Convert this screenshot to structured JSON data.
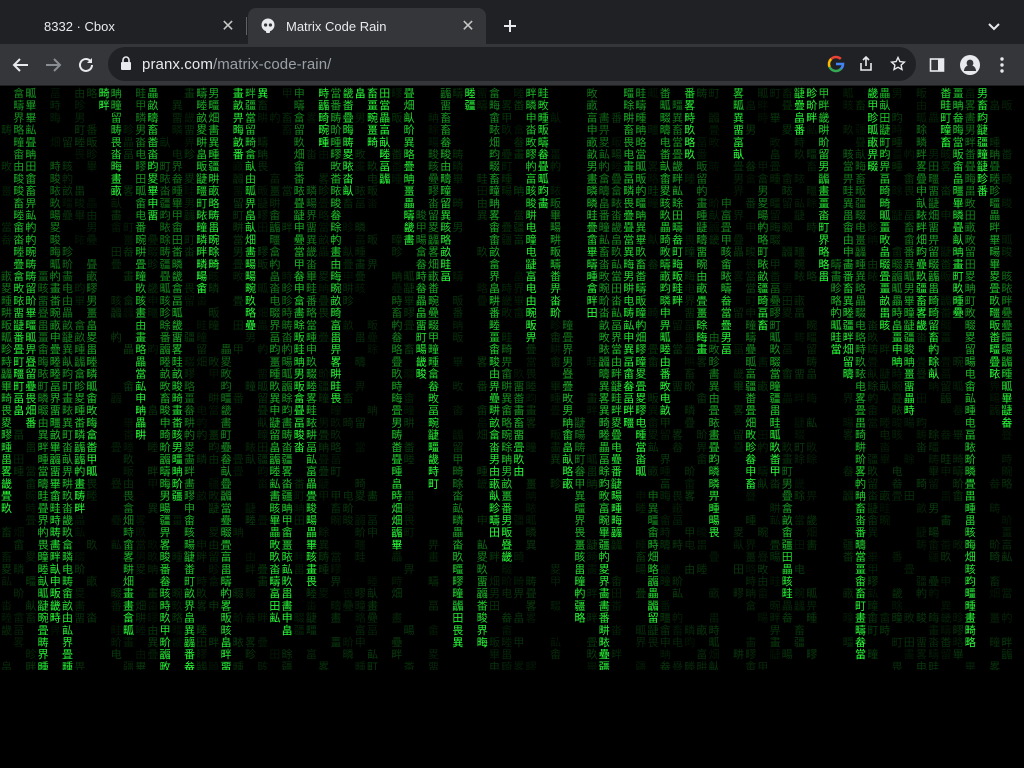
{
  "tabs": [
    {
      "title": "8332 · Cbox",
      "active": false
    },
    {
      "title": "Matrix Code Rain",
      "active": true
    }
  ],
  "toolbar": {
    "url_host": "pranx.com",
    "url_path": "/matrix-code-rain/"
  },
  "icons": {
    "back": "back-arrow-icon",
    "forward": "forward-arrow-icon",
    "reload": "reload-icon",
    "lock": "lock-icon",
    "google": "google-icon",
    "share": "share-icon",
    "bookmark": "star-icon",
    "side_panel": "side-panel-icon",
    "profile": "profile-icon",
    "menu": "kebab-menu-icon",
    "new_tab": "plus-icon",
    "tab_search": "chevron-down-icon"
  },
  "colors": {
    "rain_bright": "#29ff3a",
    "rain_dim": "#0a6e12",
    "background": "#000000",
    "tab_strip": "#202124",
    "toolbar": "#35363a"
  }
}
